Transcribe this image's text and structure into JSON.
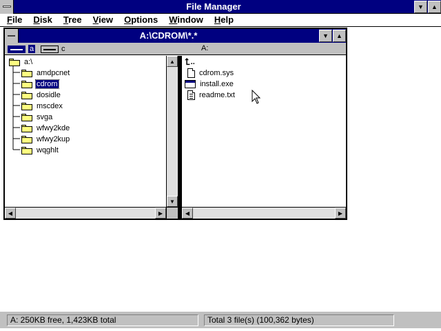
{
  "app": {
    "title": "File Manager"
  },
  "menu": [
    {
      "key": "F",
      "rest": "ile"
    },
    {
      "key": "D",
      "rest": "isk"
    },
    {
      "key": "T",
      "rest": "ree"
    },
    {
      "key": "V",
      "rest": "iew"
    },
    {
      "key": "O",
      "rest": "ptions"
    },
    {
      "key": "W",
      "rest": "indow"
    },
    {
      "key": "H",
      "rest": "elp"
    }
  ],
  "window": {
    "title": "A:\\CDROM\\*.*"
  },
  "drives": {
    "a": "a",
    "c": "c",
    "current_path": "A:"
  },
  "tree": {
    "root": "a:\\",
    "folders": [
      "amdpcnet",
      "cdrom",
      "dosidle",
      "mscdex",
      "svga",
      "wfwy2kde",
      "wfwy2kup",
      "wqghlt"
    ],
    "selected_index": 1
  },
  "files": {
    "up_label": "..",
    "items": [
      {
        "name": "cdrom.sys",
        "icon": "document-icon"
      },
      {
        "name": "install.exe",
        "icon": "program-icon"
      },
      {
        "name": "readme.txt",
        "icon": "text-file-icon"
      }
    ]
  },
  "status": {
    "left": "A: 250KB free,  1,423KB total",
    "right": "Total 3 file(s) (100,362 bytes)"
  },
  "colors": {
    "titlebar": "#000080",
    "chrome": "#c0c0c0",
    "folder": "#ffff80"
  }
}
